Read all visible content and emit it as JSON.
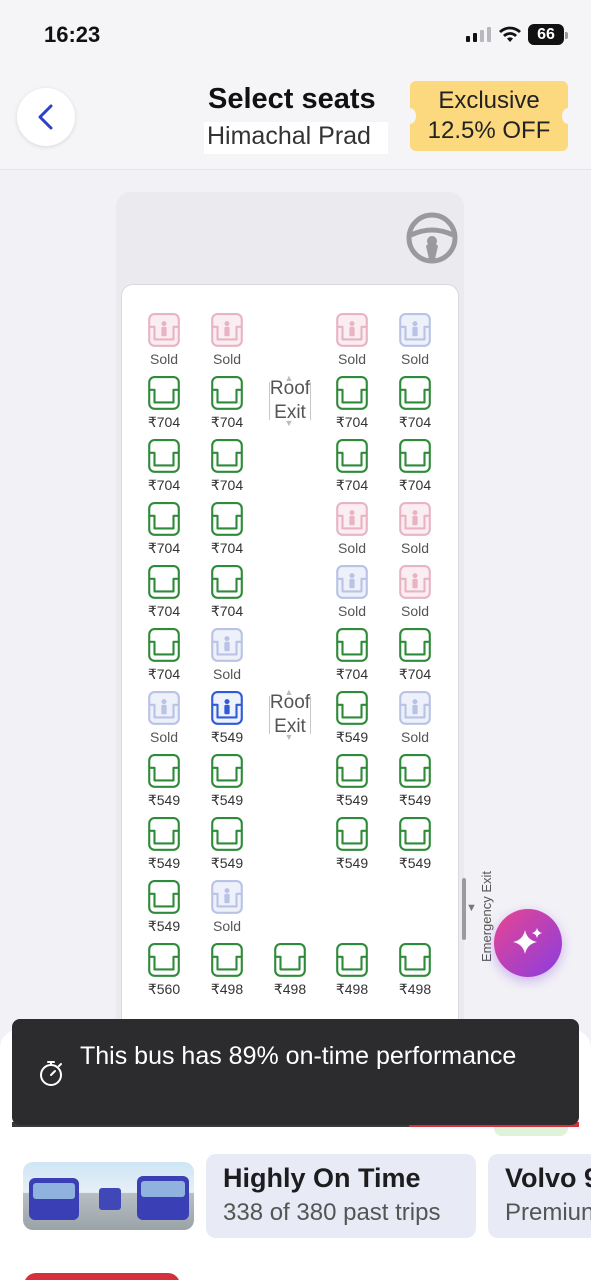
{
  "status_bar": {
    "time": "16:23",
    "battery": "66"
  },
  "header": {
    "title": "Select seats",
    "subtitle": "Himachal Prad",
    "promo_line1": "Exclusive",
    "promo_line2": "12.5% OFF"
  },
  "roof_exit_label": {
    "line1": "Roof",
    "line2": "Exit"
  },
  "emergency_exit_label": "Emergency Exit",
  "colors": {
    "available": "#2e8b3a",
    "sold_female": "#e8b4c4",
    "sold_male": "#b8c3e6",
    "selected": "#2f5bd8",
    "accent_red": "#d6303c"
  },
  "seat_rows": [
    [
      {
        "label": "Sold",
        "state": "sold_female"
      },
      {
        "label": "Sold",
        "state": "sold_female"
      },
      null,
      {
        "label": "Sold",
        "state": "sold_female"
      },
      {
        "label": "Sold",
        "state": "sold_male"
      }
    ],
    [
      {
        "label": "₹704",
        "state": "available"
      },
      {
        "label": "₹704",
        "state": "available"
      },
      null,
      {
        "label": "₹704",
        "state": "available"
      },
      {
        "label": "₹704",
        "state": "available"
      }
    ],
    [
      {
        "label": "₹704",
        "state": "available"
      },
      {
        "label": "₹704",
        "state": "available"
      },
      null,
      {
        "label": "₹704",
        "state": "available"
      },
      {
        "label": "₹704",
        "state": "available"
      }
    ],
    [
      {
        "label": "₹704",
        "state": "available"
      },
      {
        "label": "₹704",
        "state": "available"
      },
      null,
      {
        "label": "Sold",
        "state": "sold_female"
      },
      {
        "label": "Sold",
        "state": "sold_female"
      }
    ],
    [
      {
        "label": "₹704",
        "state": "available"
      },
      {
        "label": "₹704",
        "state": "available"
      },
      null,
      {
        "label": "Sold",
        "state": "sold_male"
      },
      {
        "label": "Sold",
        "state": "sold_female"
      }
    ],
    [
      {
        "label": "₹704",
        "state": "available"
      },
      {
        "label": "Sold",
        "state": "sold_male"
      },
      null,
      {
        "label": "₹704",
        "state": "available"
      },
      {
        "label": "₹704",
        "state": "available"
      }
    ],
    [
      {
        "label": "Sold",
        "state": "sold_male"
      },
      {
        "label": "₹549",
        "state": "selected"
      },
      null,
      {
        "label": "₹549",
        "state": "available"
      },
      {
        "label": "Sold",
        "state": "sold_male"
      }
    ],
    [
      {
        "label": "₹549",
        "state": "available"
      },
      {
        "label": "₹549",
        "state": "available"
      },
      null,
      {
        "label": "₹549",
        "state": "available"
      },
      {
        "label": "₹549",
        "state": "available"
      }
    ],
    [
      {
        "label": "₹549",
        "state": "available"
      },
      {
        "label": "₹549",
        "state": "available"
      },
      null,
      {
        "label": "₹549",
        "state": "available"
      },
      {
        "label": "₹549",
        "state": "available"
      }
    ],
    [
      {
        "label": "₹549",
        "state": "available"
      },
      {
        "label": "Sold",
        "state": "sold_male"
      },
      null,
      null,
      null
    ],
    [
      {
        "label": "₹560",
        "state": "available"
      },
      {
        "label": "₹498",
        "state": "available"
      },
      {
        "label": "₹498",
        "state": "available"
      },
      {
        "label": "₹498",
        "state": "available"
      },
      {
        "label": "₹498",
        "state": "available"
      }
    ]
  ],
  "toast": {
    "text": "This bus has 89% on-time performance",
    "icon": "stopwatch-icon"
  },
  "progress": {
    "filled_fraction": 0.3
  },
  "info_cards": [
    {
      "title": "Highly On Time",
      "subtitle": "338 of 380 past trips"
    },
    {
      "title": "Volvo 9",
      "subtitle": "Premiun"
    }
  ]
}
